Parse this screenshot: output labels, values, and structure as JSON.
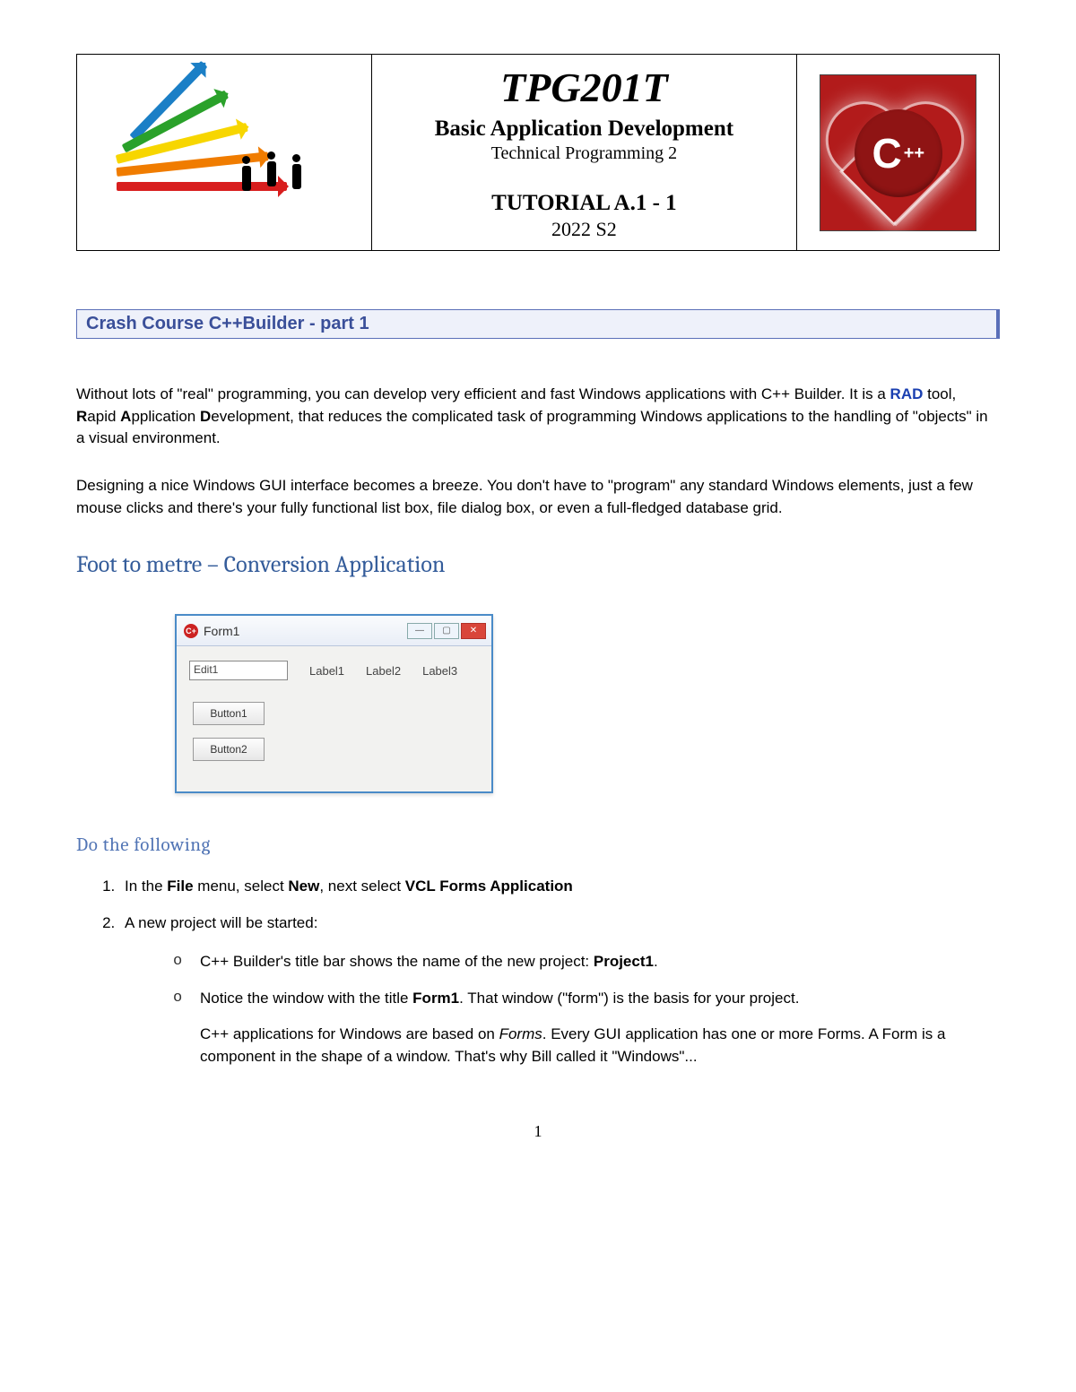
{
  "header": {
    "course_code": "TPG201T",
    "course_title": "Basic Application Development",
    "course_subtitle": "Technical Programming 2",
    "tutorial": "TUTORIAL A.1 - 1",
    "term": "2022 S2",
    "logo_letter": "C",
    "logo_plus": "++"
  },
  "banner": {
    "title": "Crash Course C++Builder - part 1"
  },
  "intro": {
    "p1_a": "Without lots of \"real\" programming, you can develop very efficient and fast Windows applications with C++ Builder. It is a ",
    "rad": "RAD",
    "p1_b": " tool, ",
    "r1": "R",
    "r1t": "apid ",
    "a1": "A",
    "a1t": "pplication ",
    "d1": "D",
    "d1t": "evelopment, that reduces the complicated task of programming Windows applications to the handling of \"objects\" in a visual environment.",
    "p2": "Designing a nice Windows GUI interface becomes a breeze. You don't have to \"program\" any standard Windows elements, just a few mouse clicks and there's your fully functional list box, file dialog box, or even a full-fledged database grid."
  },
  "section": {
    "title": "Foot to metre – Conversion Application"
  },
  "form": {
    "icon_text": "C+",
    "title": "Form1",
    "edit_value": "Edit1",
    "labels": [
      "Label1",
      "Label2",
      "Label3"
    ],
    "button1": "Button1",
    "button2": "Button2",
    "win_min": "—",
    "win_max": "▢",
    "win_close": "✕"
  },
  "steps_head": "Do the following",
  "steps": {
    "s1_a": "In the ",
    "s1_file": "File",
    "s1_b": " menu, select ",
    "s1_new": "New",
    "s1_c": ", next select ",
    "s1_vcl": "VCL Forms Application",
    "s2": "A new project will be started:",
    "sub1_a": "C++ Builder's title bar shows the name of the new project: ",
    "sub1_proj": "Project1",
    "sub1_b": ".",
    "sub2_a": "Notice the window with the title ",
    "sub2_form": "Form1",
    "sub2_b": ". That window (\"form\") is the basis for your project.",
    "sub3_a": "C++ applications for Windows are based on ",
    "sub3_forms": "Forms",
    "sub3_b": ". Every GUI application has one or more Forms. A Form is a component in the shape of a window. That's why Bill called it \"Windows\"..."
  },
  "page_number": "1"
}
